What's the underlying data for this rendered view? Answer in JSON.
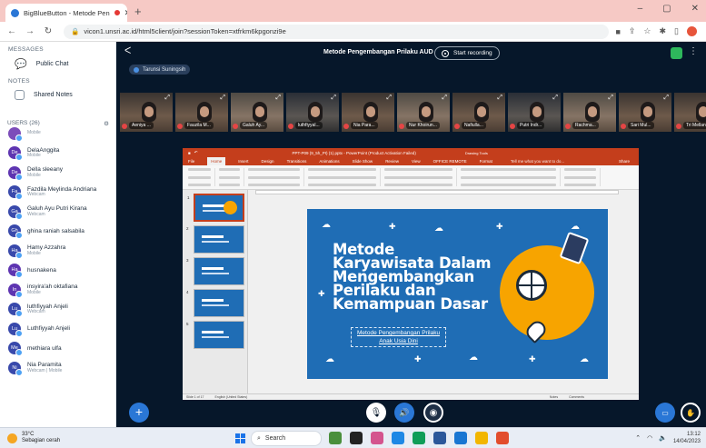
{
  "browser": {
    "tab_title": "BigBlueButton - Metode Pen",
    "new_tab": "+",
    "url": "vicon1.unsri.ac.id/html5client/join?sessionToken=xtfrkm6kpgonzi9e",
    "window_controls": {
      "minimize": "–",
      "maximize": "▢",
      "close": "✕"
    }
  },
  "sidebar": {
    "messages_heading": "MESSAGES",
    "public_chat": "Public Chat",
    "notes_heading": "NOTES",
    "shared_notes": "Shared Notes",
    "users_heading": "USERS (26)",
    "users": [
      {
        "initials": "",
        "name": "",
        "status": "Mobile",
        "color": "#7c4dba"
      },
      {
        "initials": "De",
        "name": "DelaAnggita",
        "status": "Mobile",
        "color": "#5e35b1"
      },
      {
        "initials": "De",
        "name": "Della sleeany",
        "status": "Mobile",
        "color": "#5e35b1"
      },
      {
        "initials": "Fa",
        "name": "Fazdila Meylinda Andriana",
        "status": "Webcam",
        "color": "#3949ab"
      },
      {
        "initials": "Ga",
        "name": "Galuh Ayu Putri Kirana",
        "status": "Webcam",
        "color": "#3949ab"
      },
      {
        "initials": "Gh",
        "name": "ghina raniah salsabila",
        "status": "",
        "color": "#3949ab"
      },
      {
        "initials": "Ha",
        "name": "Hamy Azzahra",
        "status": "Mobile",
        "color": "#3949ab"
      },
      {
        "initials": "Ha",
        "name": "husnakena",
        "status": "",
        "color": "#5e35b1"
      },
      {
        "initials": "In",
        "name": "insyira'ah oktafiana",
        "status": "Mobile",
        "color": "#5e35b1"
      },
      {
        "initials": "Lu",
        "name": "luthfiyyah Anjeli",
        "status": "Webcam",
        "color": "#3949ab"
      },
      {
        "initials": "Lu",
        "name": "Luthfiyyah Anjeli",
        "status": "",
        "color": "#3949ab"
      },
      {
        "initials": "Me",
        "name": "methiara ulfa",
        "status": "",
        "color": "#3949ab"
      },
      {
        "initials": "Ni",
        "name": "Nia Paramita",
        "status": "Webcam | Mobile",
        "color": "#3949ab"
      }
    ]
  },
  "meeting": {
    "title": "Metode Pengembangan Prilaku AUD",
    "record_label": "Start recording",
    "presenter": "Tarunsi Suningsih"
  },
  "cameras": [
    {
      "name": "Aeniya ..."
    },
    {
      "name": "Fauzila M..."
    },
    {
      "name": "Galuh Ay..."
    },
    {
      "name": "luthfiyyal..."
    },
    {
      "name": "Nia Para..."
    },
    {
      "name": "Nur Khoirun..."
    },
    {
      "name": "Nafiulla..."
    },
    {
      "name": "Putri Indr..."
    },
    {
      "name": "Rachma..."
    },
    {
      "name": "Sari Mul..."
    },
    {
      "name": "Tri Mellani..."
    }
  ],
  "powerpoint": {
    "title_bar": "PPT-P09 (9_5h_PI) (1).pptx - PowerPoint (Product Activation Failed)",
    "drawing_tools": "Drawing Tools",
    "menu": [
      "File",
      "Home",
      "Insert",
      "Design",
      "Transitions",
      "Animations",
      "Slide Show",
      "Review",
      "View",
      "OFFICE REMOTE",
      "Format"
    ],
    "tell_me": "Tell me what you want to do...",
    "share": "Share",
    "status": [
      "Slide 1 of 17",
      "English (United States)",
      "Notes",
      "Comments"
    ],
    "slide": {
      "title_lines": [
        "Metode",
        "Karyawisata Dalam",
        "Mengembangkan",
        "Perilaku dan",
        "Kemampuan Dasar"
      ],
      "subtitle_lines": [
        "Metode Pengembangan Prilaku",
        "Anak Usia Dini"
      ]
    },
    "thumb_numbers": [
      "1",
      "2",
      "3",
      "4",
      "5"
    ]
  },
  "taskbar": {
    "weather_temp": "33°C",
    "weather_desc": "Sebagian cerah",
    "search": "Search",
    "time": "13:12",
    "date": "14/04/2023"
  }
}
